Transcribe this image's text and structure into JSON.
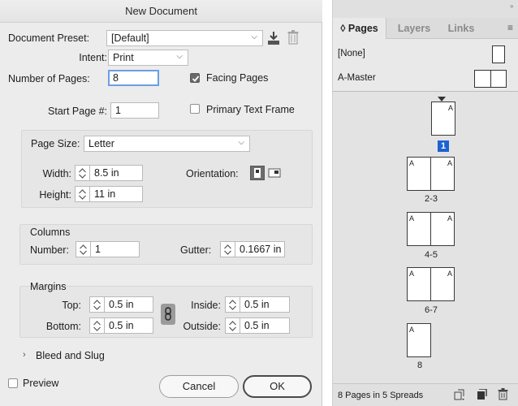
{
  "dialog": {
    "title": "New Document",
    "preset_label": "Document Preset:",
    "preset_value": "[Default]",
    "intent_label": "Intent:",
    "intent_value": "Print",
    "num_pages_label": "Number of Pages:",
    "num_pages_value": "8",
    "start_page_label": "Start Page #:",
    "start_page_value": "1",
    "facing_pages_label": "Facing Pages",
    "facing_pages_checked": true,
    "primary_text_frame_label": "Primary Text Frame",
    "primary_text_frame_checked": false,
    "page_size_label": "Page Size:",
    "page_size_value": "Letter",
    "width_label": "Width:",
    "width_value": "8.5 in",
    "height_label": "Height:",
    "height_value": "11 in",
    "orientation_label": "Orientation:",
    "columns_title": "Columns",
    "col_number_label": "Number:",
    "col_number_value": "1",
    "gutter_label": "Gutter:",
    "gutter_value": "0.1667 in",
    "margins_title": "Margins",
    "top_label": "Top:",
    "top_value": "0.5 in",
    "bottom_label": "Bottom:",
    "bottom_value": "0.5 in",
    "inside_label": "Inside:",
    "inside_value": "0.5 in",
    "outside_label": "Outside:",
    "outside_value": "0.5 in",
    "bleed_label": "Bleed and Slug",
    "preview_label": "Preview",
    "cancel_label": "Cancel",
    "ok_label": "OK"
  },
  "panel": {
    "tabs": [
      {
        "label": "◊ Pages"
      },
      {
        "label": "Layers"
      },
      {
        "label": "Links"
      }
    ],
    "masters": [
      {
        "label": "[None]"
      },
      {
        "label": "A-Master"
      }
    ],
    "pages": [
      {
        "label": "1",
        "letters": [
          "A"
        ]
      },
      {
        "label": "2-3",
        "letters": [
          "A",
          "A"
        ]
      },
      {
        "label": "4-5",
        "letters": [
          "A",
          "A"
        ]
      },
      {
        "label": "6-7",
        "letters": [
          "A",
          "A"
        ]
      },
      {
        "label": "8",
        "letters": [
          "A"
        ]
      }
    ],
    "footer_text": "8 Pages in 5 Spreads"
  }
}
